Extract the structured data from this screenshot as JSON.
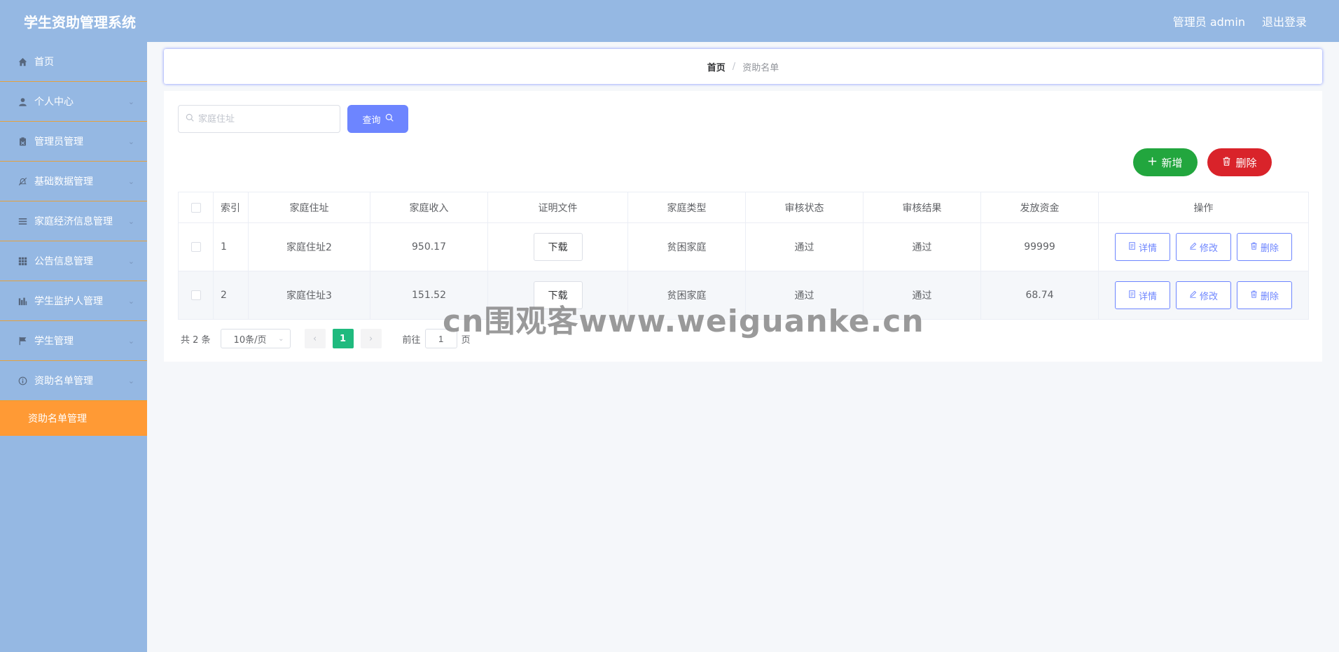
{
  "header": {
    "app_title": "学生资助管理系统",
    "user_label": "管理员 admin",
    "logout_label": "退出登录"
  },
  "sidebar": {
    "items": [
      {
        "label": "首页",
        "icon": "home-icon",
        "has_chevron": false
      },
      {
        "label": "个人中心",
        "icon": "user-icon",
        "has_chevron": true
      },
      {
        "label": "管理员管理",
        "icon": "clipboard-icon",
        "has_chevron": true
      },
      {
        "label": "基础数据管理",
        "icon": "bell-off-icon",
        "has_chevron": true
      },
      {
        "label": "家庭经济信息管理",
        "icon": "list-icon",
        "has_chevron": true
      },
      {
        "label": "公告信息管理",
        "icon": "grid-icon",
        "has_chevron": true
      },
      {
        "label": "学生监护人管理",
        "icon": "chart-icon",
        "has_chevron": true
      },
      {
        "label": "学生管理",
        "icon": "flag-icon",
        "has_chevron": true
      },
      {
        "label": "资助名单管理",
        "icon": "info-icon",
        "has_chevron": true
      }
    ],
    "active_sub": "资助名单管理"
  },
  "breadcrumb": {
    "home": "首页",
    "separator": "/",
    "current": "资助名单"
  },
  "search": {
    "placeholder": "家庭住址",
    "value": "",
    "query_label": "查询"
  },
  "actions": {
    "add_label": "新增",
    "delete_label": "删除"
  },
  "table": {
    "columns": [
      "索引",
      "家庭住址",
      "家庭收入",
      "证明文件",
      "家庭类型",
      "审核状态",
      "审核结果",
      "发放资金",
      "操作"
    ],
    "download_label": "下载",
    "op_labels": {
      "detail": "详情",
      "edit": "修改",
      "delete": "删除"
    },
    "rows": [
      {
        "index": "1",
        "address": "家庭住址2",
        "income": "950.17",
        "type": "贫困家庭",
        "status": "通过",
        "result": "通过",
        "fund": "99999"
      },
      {
        "index": "2",
        "address": "家庭住址3",
        "income": "151.52",
        "type": "贫困家庭",
        "status": "通过",
        "result": "通过",
        "fund": "68.74"
      }
    ]
  },
  "pagination": {
    "total_label": "共 2 条",
    "page_size": "10条/页",
    "current_page": "1",
    "goto_prefix": "前往",
    "goto_value": "1",
    "goto_suffix": "页"
  },
  "watermark": "cn围观客www.weiguanke.cn",
  "colors": {
    "header_bg": "#95b8e3",
    "active_menu": "#ff9a35",
    "primary": "#6d85ff",
    "success": "#22a63e",
    "danger": "#d9232a",
    "page_active": "#1fba7e"
  }
}
